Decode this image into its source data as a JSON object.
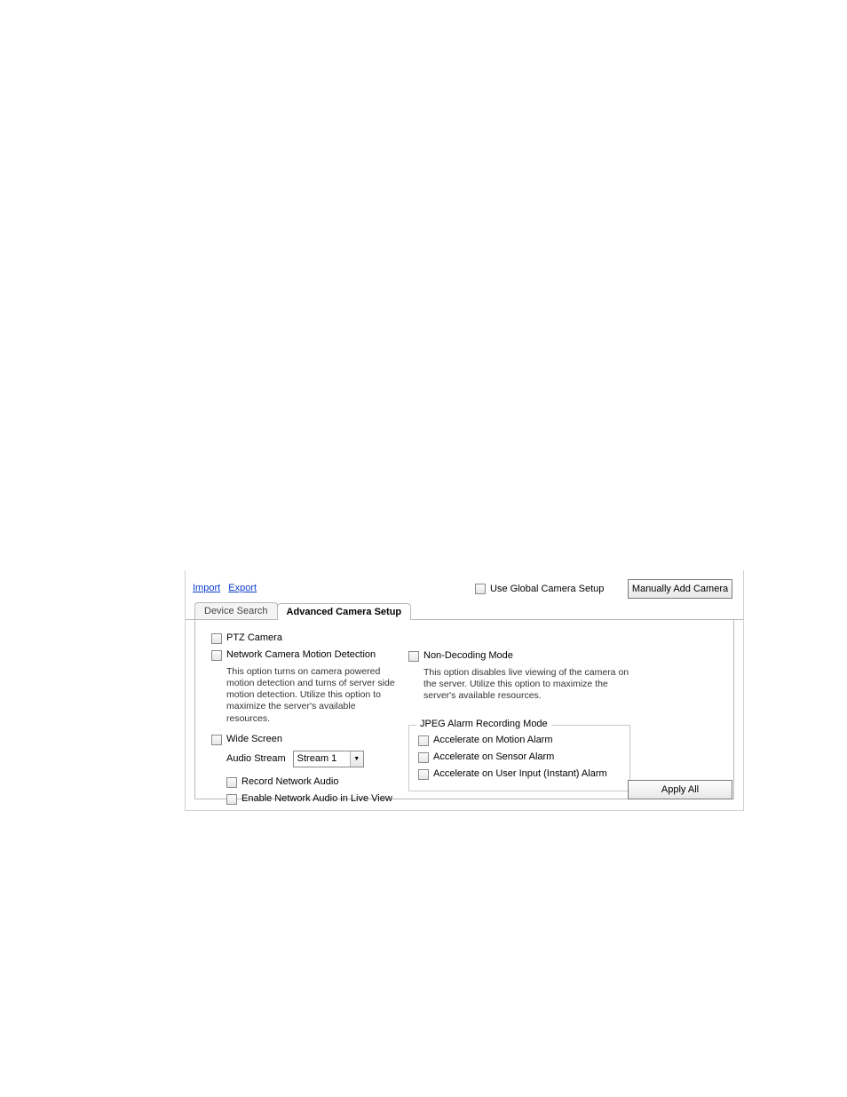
{
  "toolbar": {
    "import_link": "Import",
    "export_link": "Export",
    "use_global_label": "Use Global Camera Setup",
    "manual_add_label": "Manually Add Camera",
    "apply_all_label": "Apply All"
  },
  "tabs": {
    "device_search": "Device Search",
    "advanced": "Advanced Camera Setup"
  },
  "left": {
    "ptz_label": "PTZ Camera",
    "motion_label": "Network Camera Motion Detection",
    "motion_help": "This option turns on camera powered motion detection and turns of server side motion detection. Utilize this option to maximize the server's available resources.",
    "wide_label": "Wide Screen",
    "audio_stream_label": "Audio Stream",
    "audio_stream_value": "Stream 1",
    "record_audio_label": "Record Network Audio",
    "enable_audio_label": "Enable Network Audio in Live View"
  },
  "right": {
    "nondecode_label": "Non-Decoding Mode",
    "nondecode_help": "This option disables live viewing of the camera on the server. Utilize this option to maximize the server's available resources."
  },
  "jpeg_group": {
    "title": "JPEG Alarm Recording Mode",
    "motion_alarm": "Accelerate on Motion Alarm",
    "sensor_alarm": "Accelerate on Sensor Alarm",
    "user_alarm": "Accelerate on User Input (Instant) Alarm"
  }
}
